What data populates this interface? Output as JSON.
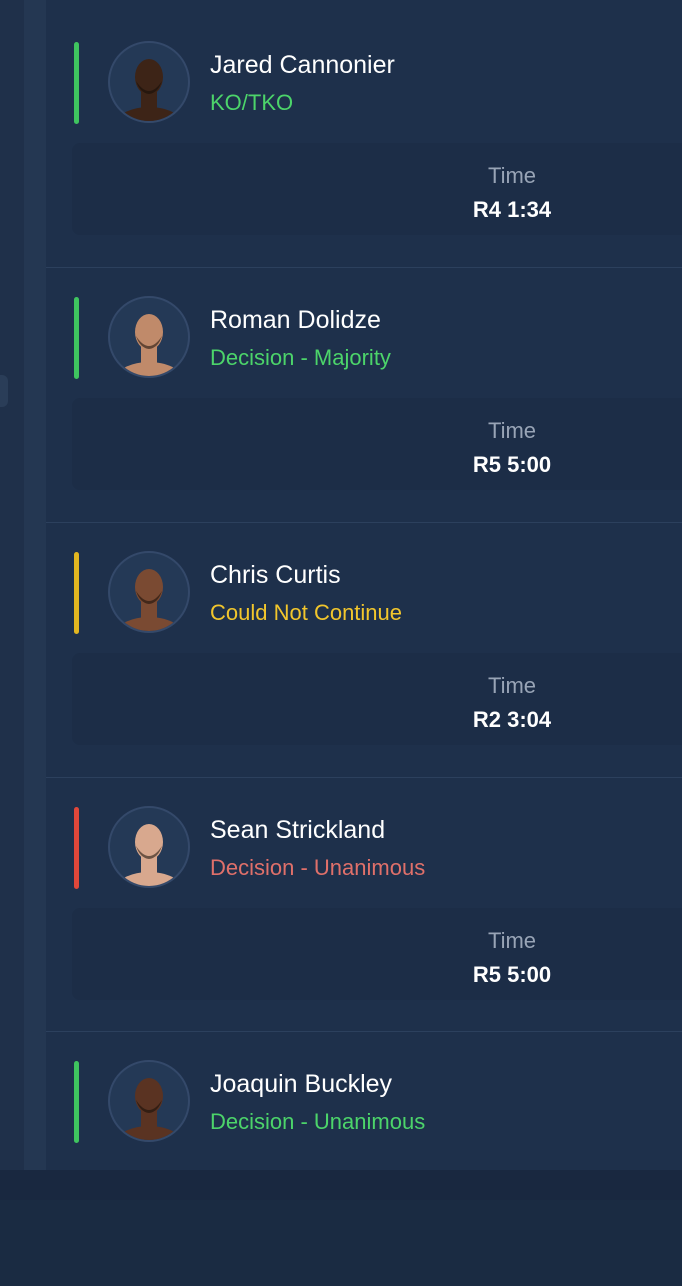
{
  "colors": {
    "win": "#3fc45f",
    "nc": "#e2b620",
    "loss": "#e0473a",
    "win_text": "#4cd46a",
    "nc_text": "#f2c62c",
    "loss_text": "#e0706a"
  },
  "fights": [
    {
      "name": "Jared Cannonier",
      "method": "KO/TKO",
      "result": "win",
      "time_label": "Time",
      "time": "R4 1:34",
      "skin": "#3d2417"
    },
    {
      "name": "Roman Dolidze",
      "method": "Decision - Majority",
      "result": "win",
      "time_label": "Time",
      "time": "R5 5:00",
      "skin": "#c08a6a"
    },
    {
      "name": "Chris Curtis",
      "method": "Could Not Continue",
      "result": "nc",
      "time_label": "Time",
      "time": "R2 3:04",
      "skin": "#7a4a32"
    },
    {
      "name": "Sean Strickland",
      "method": "Decision - Unanimous",
      "result": "loss",
      "time_label": "Time",
      "time": "R5 5:00",
      "skin": "#d8a88e"
    },
    {
      "name": "Joaquin Buckley",
      "method": "Decision - Unanimous",
      "result": "win",
      "time_label": "Time",
      "time": "",
      "skin": "#5a3322"
    }
  ]
}
